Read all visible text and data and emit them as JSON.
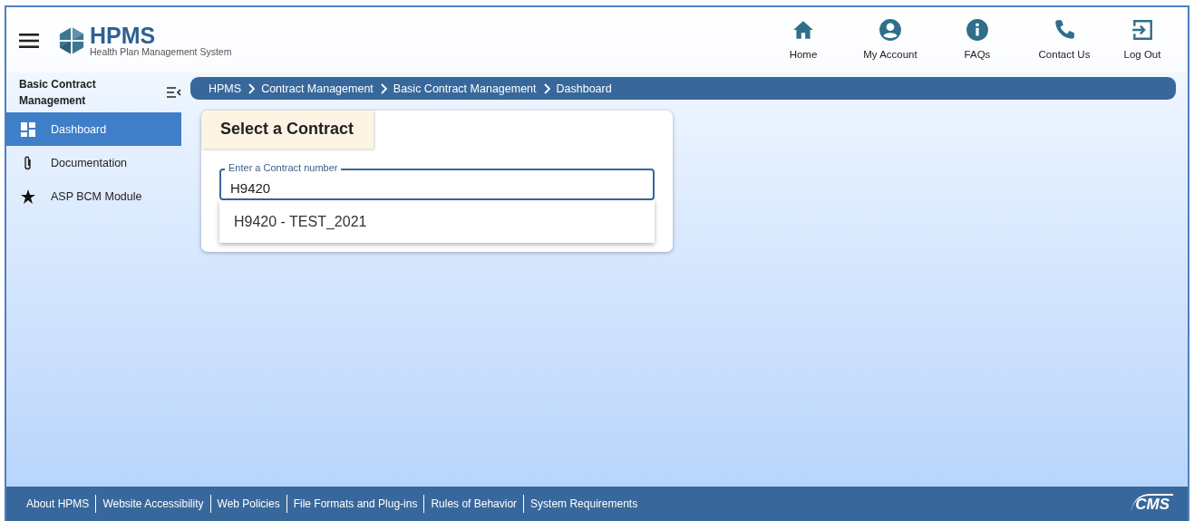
{
  "header": {
    "logo_title": "HPMS",
    "logo_subtitle": "Health Plan Management System",
    "nav": [
      {
        "kind": "home",
        "label": "Home"
      },
      {
        "kind": "account",
        "label": "My Account"
      },
      {
        "kind": "info",
        "label": "FAQs"
      },
      {
        "kind": "phone",
        "label": "Contact Us"
      },
      {
        "kind": "logout",
        "label": "Log Out"
      }
    ]
  },
  "sidebar": {
    "title": "Basic Contract Management",
    "items": [
      {
        "kind": "grid",
        "label": "Dashboard",
        "selected": true
      },
      {
        "kind": "clip",
        "label": "Documentation",
        "selected": false
      },
      {
        "kind": "star",
        "label": "ASP BCM Module",
        "selected": false
      }
    ]
  },
  "breadcrumb": [
    "HPMS",
    "Contract Management",
    "Basic Contract Management",
    "Dashboard"
  ],
  "card": {
    "title": "Select a Contract",
    "field": {
      "label": "Enter a Contract number",
      "value": "H9420"
    },
    "suggestions": [
      "H9420 - TEST_2021"
    ]
  },
  "footer": {
    "links": [
      "About HPMS",
      "Website Accessibility",
      "Web Policies",
      "File Formats and Plug-ins",
      "Rules of Behavior",
      "System Requirements"
    ],
    "logo": "CMS"
  }
}
